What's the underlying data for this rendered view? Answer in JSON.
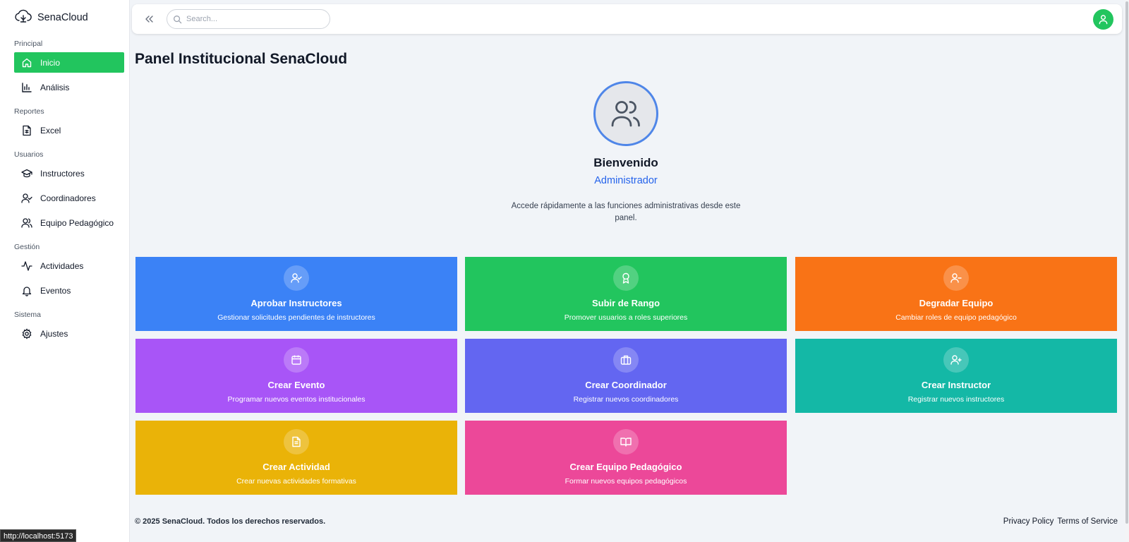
{
  "app": {
    "name": "SenaCloud"
  },
  "sidebar": {
    "sections": [
      {
        "label": "Principal",
        "items": [
          {
            "label": "Inicio",
            "icon": "home-icon",
            "active": true
          },
          {
            "label": "Análisis",
            "icon": "bar-chart-icon"
          }
        ]
      },
      {
        "label": "Reportes",
        "items": [
          {
            "label": "Excel",
            "icon": "spreadsheet-icon"
          }
        ]
      },
      {
        "label": "Usuarios",
        "items": [
          {
            "label": "Instructores",
            "icon": "graduation-cap-icon"
          },
          {
            "label": "Coordinadores",
            "icon": "user-check-icon"
          },
          {
            "label": "Equipo Pedagógico",
            "icon": "users-icon"
          }
        ]
      },
      {
        "label": "Gestión",
        "items": [
          {
            "label": "Actividades",
            "icon": "activity-icon"
          },
          {
            "label": "Eventos",
            "icon": "bell-icon"
          }
        ]
      },
      {
        "label": "Sistema",
        "items": [
          {
            "label": "Ajustes",
            "icon": "gear-icon"
          }
        ]
      }
    ]
  },
  "header": {
    "search_placeholder": "Search..."
  },
  "main": {
    "title": "Panel Institucional SenaCloud",
    "welcome_title": "Bienvenido",
    "welcome_role": "Administrador",
    "welcome_text": "Accede rápidamente a las funciones administrativas desde este panel.",
    "cards": [
      {
        "title": "Aprobar Instructores",
        "subtitle": "Gestionar solicitudes pendientes de instructores",
        "color": "#3b82f6",
        "icon": "user-check-icon"
      },
      {
        "title": "Subir de Rango",
        "subtitle": "Promover usuarios a roles superiores",
        "color": "#22c55e",
        "icon": "award-icon"
      },
      {
        "title": "Degradar Equipo",
        "subtitle": "Cambiar roles de equipo pedagógico",
        "color": "#f97316",
        "icon": "user-minus-icon"
      },
      {
        "title": "Crear Evento",
        "subtitle": "Programar nuevos eventos institucionales",
        "color": "#a855f7",
        "icon": "calendar-icon"
      },
      {
        "title": "Crear Coordinador",
        "subtitle": "Registrar nuevos coordinadores",
        "color": "#6366f1",
        "icon": "briefcase-icon"
      },
      {
        "title": "Crear Instructor",
        "subtitle": "Registrar nuevos instructores",
        "color": "#14b8a6",
        "icon": "user-plus-icon"
      },
      {
        "title": "Crear Actividad",
        "subtitle": "Crear nuevas actividades formativas",
        "color": "#eab308",
        "icon": "document-icon"
      },
      {
        "title": "Crear Equipo Pedagógico",
        "subtitle": "Formar nuevos equipos pedagógicos",
        "color": "#ec4899",
        "icon": "book-open-icon"
      }
    ]
  },
  "footer": {
    "copyright": "© 2025 SenaCloud. Todos los derechos reservados.",
    "privacy": "Privacy Policy",
    "terms": "Terms of Service"
  },
  "status_bar": {
    "url": "http://localhost:5173"
  }
}
